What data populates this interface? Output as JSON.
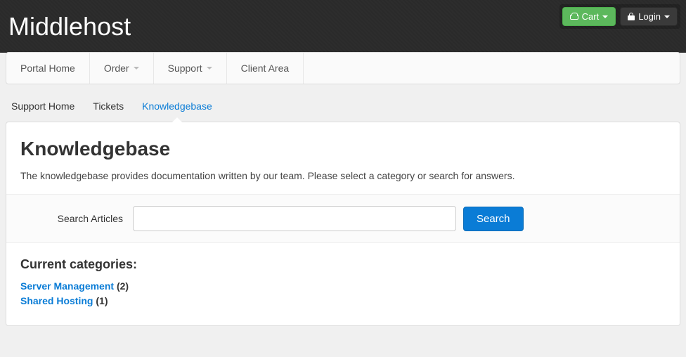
{
  "header": {
    "logo": "Middlehost",
    "cart_label": "Cart",
    "login_label": "Login"
  },
  "main_nav": {
    "items": [
      {
        "label": "Portal Home",
        "dropdown": false
      },
      {
        "label": "Order",
        "dropdown": true
      },
      {
        "label": "Support",
        "dropdown": true
      },
      {
        "label": "Client Area",
        "dropdown": false
      }
    ]
  },
  "sub_nav": {
    "items": [
      {
        "label": "Support Home",
        "active": false
      },
      {
        "label": "Tickets",
        "active": false
      },
      {
        "label": "Knowledgebase",
        "active": true
      }
    ]
  },
  "page": {
    "title": "Knowledgebase",
    "description": "The knowledgebase provides documentation written by our team. Please select a category or search for answers."
  },
  "search": {
    "label": "Search Articles",
    "placeholder": "",
    "button": "Search"
  },
  "categories": {
    "heading": "Current categories:",
    "items": [
      {
        "name": "Server Management",
        "count": 2
      },
      {
        "name": "Shared Hosting",
        "count": 1
      }
    ]
  }
}
